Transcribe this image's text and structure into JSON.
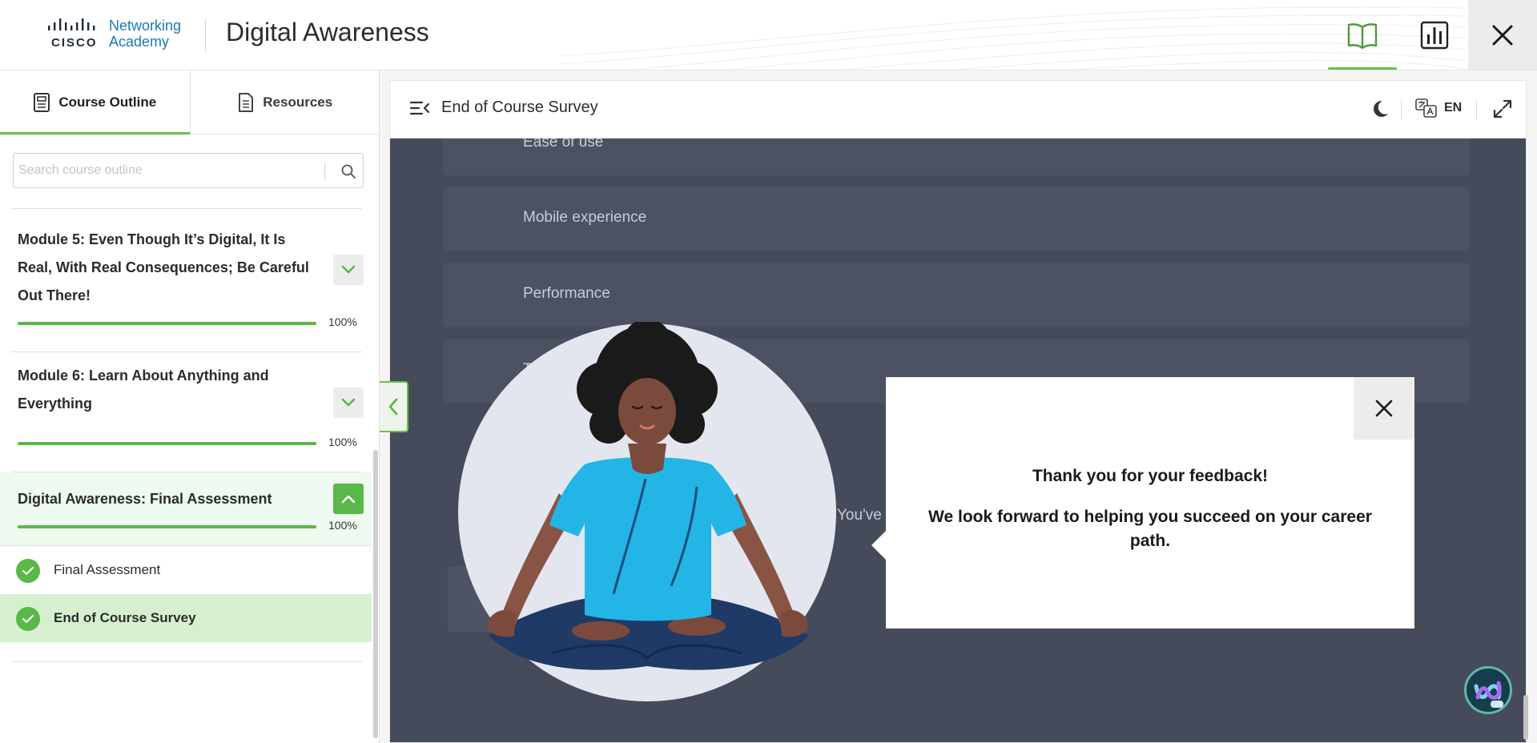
{
  "header": {
    "logo_brand": "CISCO",
    "logo_line1": "Networking",
    "logo_line2": "Academy",
    "app_title": "Digital Awareness",
    "buttons": [
      {
        "icon": "book-icon",
        "active": true
      },
      {
        "icon": "bar-chart-icon",
        "active": false
      },
      {
        "icon": "close-icon",
        "active": false
      }
    ]
  },
  "sidebar": {
    "tabs": [
      {
        "label": "Course Outline",
        "icon": "outline-doc-icon",
        "active": true
      },
      {
        "label": "Resources",
        "icon": "document-icon",
        "active": false
      }
    ],
    "search": {
      "placeholder": "Search course outline",
      "value": ""
    },
    "modules": [
      {
        "title": "Module 5: Even Though It’s Digital, It Is Real, With Real Consequences; Be Careful Out There!",
        "progress": 100,
        "progress_label": "100%",
        "expanded": false
      },
      {
        "title": "Module 6: Learn About Anything and Everything",
        "progress": 100,
        "progress_label": "100%",
        "expanded": false
      },
      {
        "title": "Digital Awareness: Final Assessment",
        "progress": 100,
        "progress_label": "100%",
        "expanded": true
      }
    ],
    "lessons": [
      {
        "label": "Final Assessment",
        "complete": true,
        "selected": false
      },
      {
        "label": "End of Course Survey",
        "complete": true,
        "selected": true
      }
    ]
  },
  "main": {
    "page_title": "End of Course Survey",
    "language": "EN",
    "survey_options": [
      "Ease of use",
      "Mobile experience",
      "Performance",
      "T"
    ],
    "partial_text": "You've"
  },
  "popup": {
    "title": "Thank you for your feedback!",
    "message": "We look forward to helping you succeed on your career path."
  },
  "colors": {
    "accent_green": "#59b848",
    "overlay": "#464b5b",
    "academy_blue": "#1b79b3"
  }
}
